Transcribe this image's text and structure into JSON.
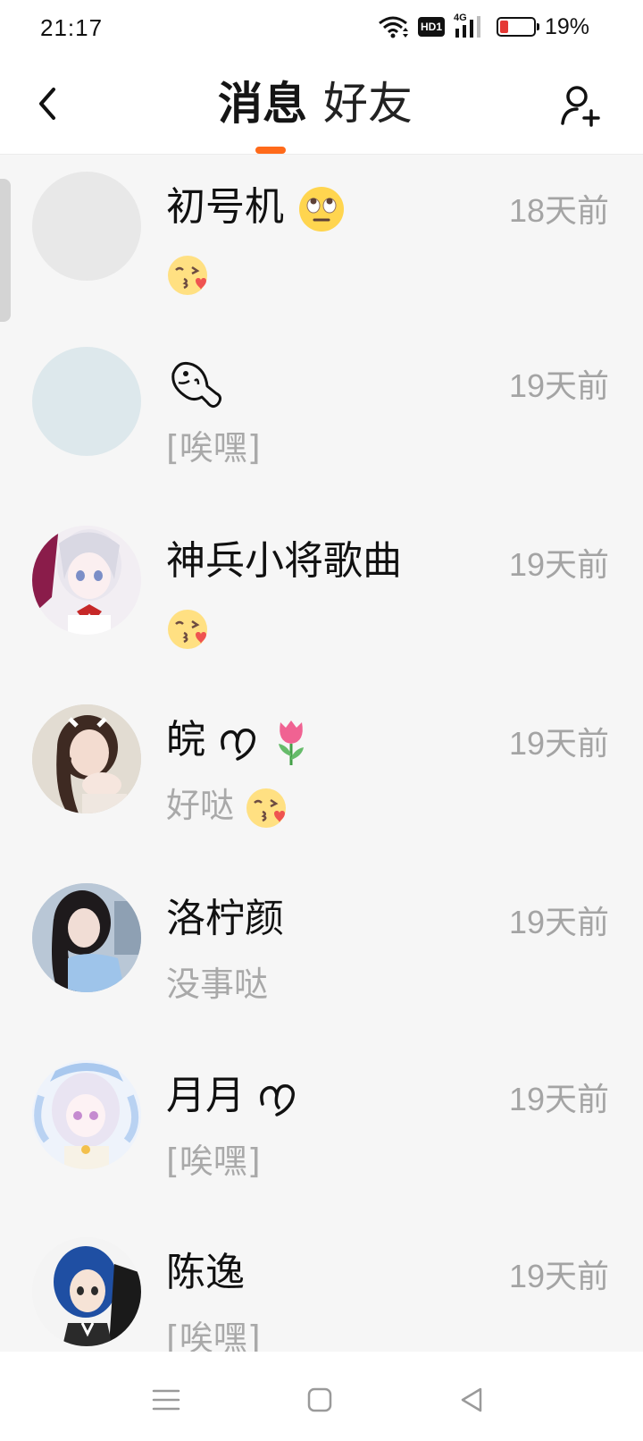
{
  "status_bar": {
    "time": "21:17",
    "network": "4G",
    "hd_label": "HD1",
    "battery": "19%",
    "battery_color": "#e53935"
  },
  "header": {
    "tab_messages": "消息",
    "tab_friends": "好友",
    "accent_color": "#ff6a1a",
    "back_icon": "chevron-left-icon",
    "add_icon": "add-user-icon"
  },
  "chats": [
    {
      "name": "初号机",
      "name_emoji": "eye-roll-emoji",
      "time": "18天前",
      "message": "",
      "message_emoji": "kiss-wink-emoji"
    },
    {
      "name": "",
      "name_emoji": "cartoon-fish-emoji",
      "time": "19天前",
      "message": "[唉嘿]",
      "message_emoji": ""
    },
    {
      "name": "神兵小将歌曲",
      "name_emoji": "",
      "time": "19天前",
      "message": "",
      "message_emoji": "kiss-wink-emoji"
    },
    {
      "name": "皖",
      "name_emoji": "heart-script tulip-emoji",
      "time": "19天前",
      "message": "好哒",
      "message_emoji": "kiss-wink-emoji"
    },
    {
      "name": "洛柠颜",
      "name_emoji": "",
      "time": "19天前",
      "message": "没事哒",
      "message_emoji": ""
    },
    {
      "name": "月月",
      "name_emoji": "heart-script",
      "time": "19天前",
      "message": "[唉嘿]",
      "message_emoji": ""
    },
    {
      "name": "陈逸",
      "name_emoji": "",
      "time": "19天前",
      "message": "[唉嘿]",
      "message_emoji": ""
    }
  ],
  "nav": {
    "menu_icon": "menu-icon",
    "home_icon": "home-square-icon",
    "back_icon": "back-triangle-icon"
  }
}
